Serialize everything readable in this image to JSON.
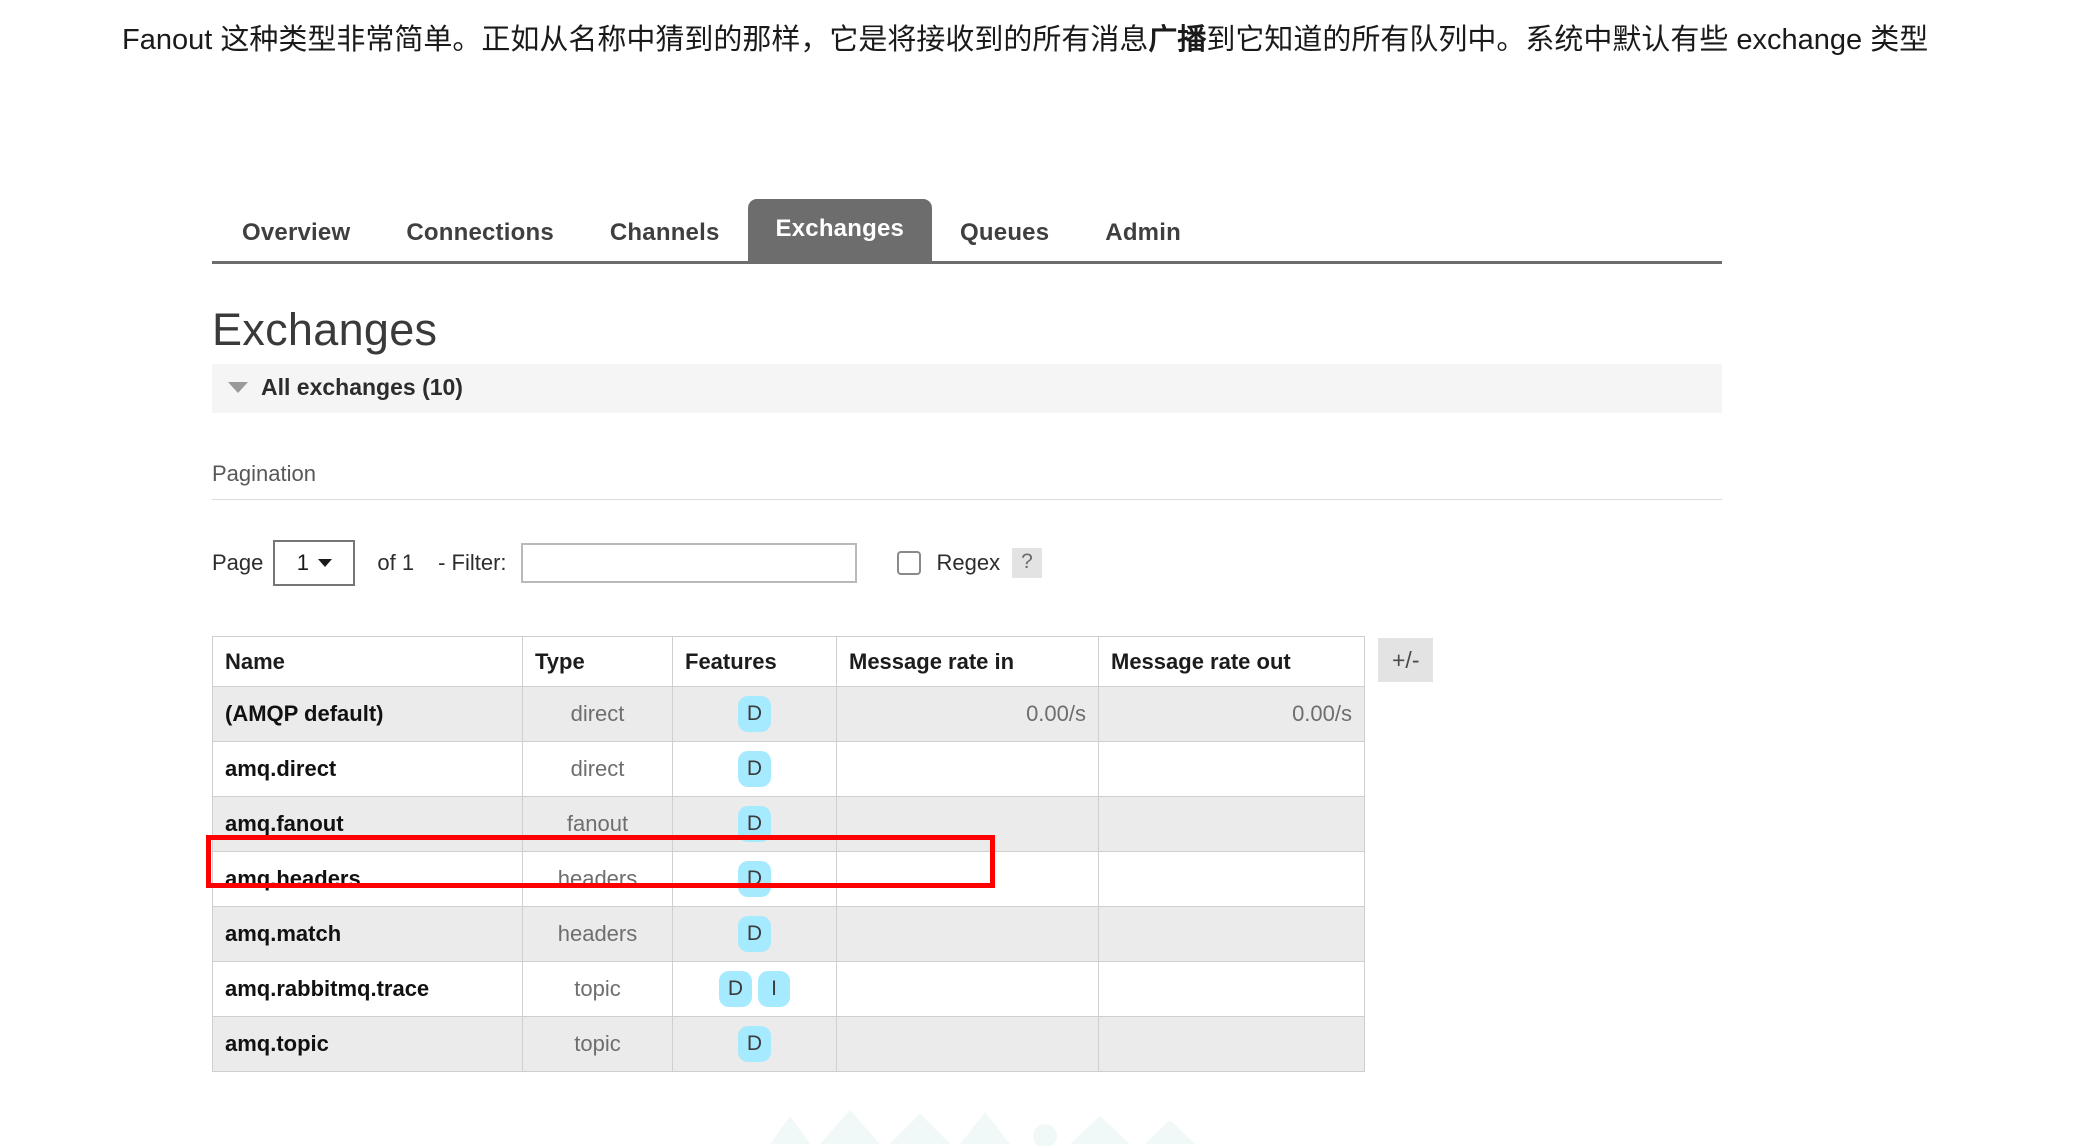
{
  "article": {
    "paragraph_html": "Fanout 这种类型非常简单。正如从名称中猜到的那样，它是将接收到的所有消息<b>广播</b>到它知道的所有队列中。系统中默认有些 exchange 类型",
    "paragraph_text": "Fanout 这种类型非常简单。正如从名称中猜到的那样，它是将接收到的所有消息广播到它知道的所有队列中。系统中默认有些 exchange 类型"
  },
  "nav": {
    "tabs": [
      {
        "label": "Overview",
        "selected": false
      },
      {
        "label": "Connections",
        "selected": false
      },
      {
        "label": "Channels",
        "selected": false
      },
      {
        "label": "Exchanges",
        "selected": true
      },
      {
        "label": "Queues",
        "selected": false
      },
      {
        "label": "Admin",
        "selected": false
      }
    ]
  },
  "page": {
    "title": "Exchanges",
    "section_header": "All exchanges (10)",
    "caret_icon": "caret-down-icon"
  },
  "pagination": {
    "label": "Pagination",
    "page_text": "Page",
    "page_value": "1",
    "of_text": "of 1",
    "filter_label": "- Filter:",
    "filter_value": "",
    "filter_placeholder": "",
    "regex_label": "Regex",
    "regex_checked": false,
    "help_label": "?"
  },
  "table": {
    "columns": [
      "Name",
      "Type",
      "Features",
      "Message rate in",
      "Message rate out"
    ],
    "plus_minus_label": "+/-",
    "rows": [
      {
        "name": "(AMQP default)",
        "type": "direct",
        "features": [
          "D"
        ],
        "rate_in": "0.00/s",
        "rate_out": "0.00/s"
      },
      {
        "name": "amq.direct",
        "type": "direct",
        "features": [
          "D"
        ],
        "rate_in": "",
        "rate_out": ""
      },
      {
        "name": "amq.fanout",
        "type": "fanout",
        "features": [
          "D"
        ],
        "rate_in": "",
        "rate_out": ""
      },
      {
        "name": "amq.headers",
        "type": "headers",
        "features": [
          "D"
        ],
        "rate_in": "",
        "rate_out": ""
      },
      {
        "name": "amq.match",
        "type": "headers",
        "features": [
          "D"
        ],
        "rate_in": "",
        "rate_out": ""
      },
      {
        "name": "amq.rabbitmq.trace",
        "type": "topic",
        "features": [
          "D",
          "I"
        ],
        "rate_in": "",
        "rate_out": ""
      },
      {
        "name": "amq.topic",
        "type": "topic",
        "features": [
          "D"
        ],
        "rate_in": "",
        "rate_out": ""
      }
    ]
  },
  "annotation": {
    "highlight_row_name": "amq.fanout",
    "highlight_color": "#ff0000"
  },
  "colors": {
    "tab_selected_bg": "#6d6d6d",
    "badge_bg": "#a6eaff",
    "row_alt_bg": "#ebebeb",
    "section_bg": "#f5f5f5",
    "watermark": "#cfeee6"
  }
}
